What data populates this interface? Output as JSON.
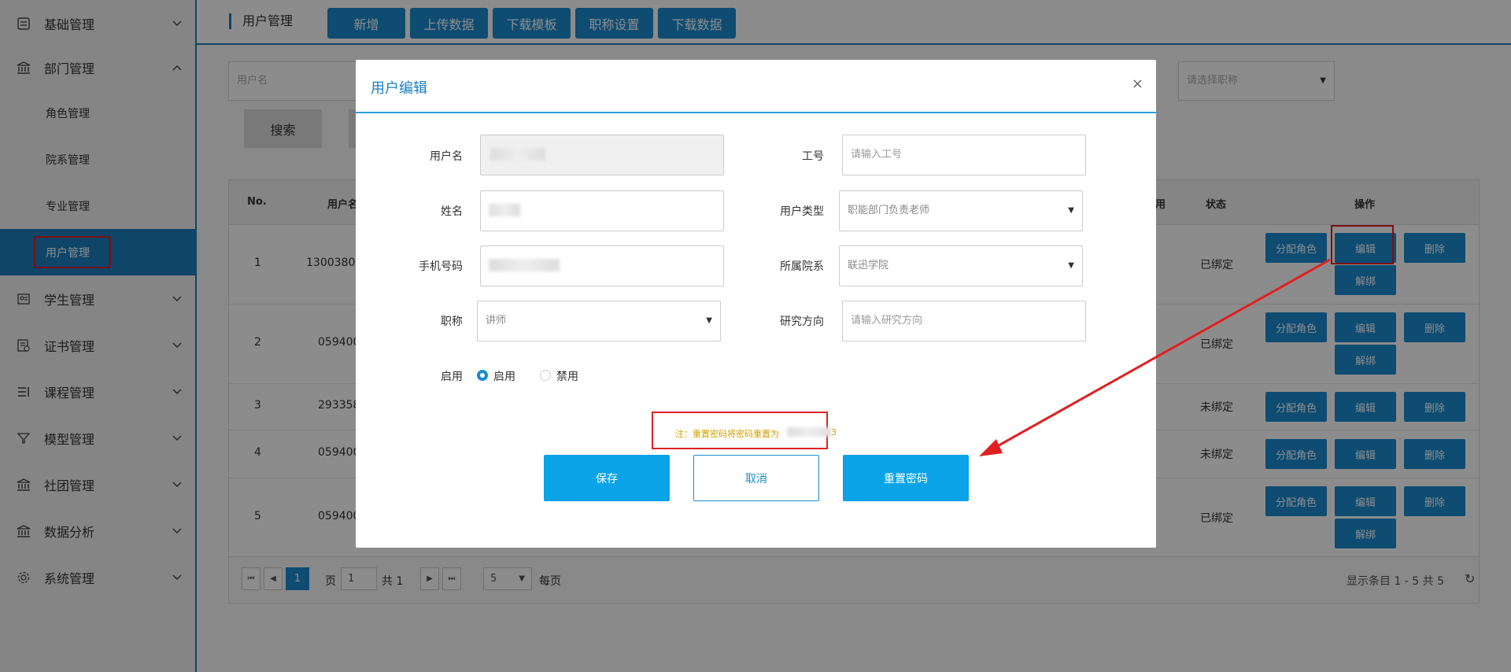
{
  "sidebar": {
    "items": [
      {
        "label": "基础管理",
        "icon": "list-icon",
        "expanded": false
      },
      {
        "label": "部门管理",
        "icon": "bank-icon",
        "expanded": true,
        "children": [
          "角色管理",
          "院系管理",
          "专业管理",
          "用户管理"
        ]
      },
      {
        "label": "学生管理",
        "icon": "student-icon",
        "expanded": false
      },
      {
        "label": "证书管理",
        "icon": "certificate-icon",
        "expanded": false
      },
      {
        "label": "课程管理",
        "icon": "course-icon",
        "expanded": false
      },
      {
        "label": "模型管理",
        "icon": "funnel-icon",
        "expanded": false
      },
      {
        "label": "社团管理",
        "icon": "bank-icon",
        "expanded": false
      },
      {
        "label": "数据分析",
        "icon": "bank-icon",
        "expanded": false
      },
      {
        "label": "系统管理",
        "icon": "gear-icon",
        "expanded": false
      }
    ]
  },
  "header": {
    "title": "用户管理",
    "buttons": [
      "新增",
      "上传数据",
      "下载模板",
      "职称设置",
      "下载数据"
    ]
  },
  "filters": {
    "username_placeholder": "用户名",
    "title_placeholder": "请选择职称",
    "search_label": "搜索"
  },
  "table": {
    "headers": {
      "no": "No.",
      "username": "用户名",
      "enabled": "用",
      "status": "状态",
      "actions": "操作"
    },
    "rows": [
      {
        "no": "1",
        "username": "13003804",
        "status": "已绑定",
        "unbind": true
      },
      {
        "no": "2",
        "username": "059400",
        "status": "已绑定",
        "unbind": true
      },
      {
        "no": "3",
        "username": "293358",
        "status": "未绑定",
        "unbind": false
      },
      {
        "no": "4",
        "username": "059400",
        "status": "未绑定",
        "unbind": false
      },
      {
        "no": "5",
        "username": "059400",
        "status": "已绑定",
        "unbind": true
      }
    ],
    "action_labels": {
      "assign_role": "分配角色",
      "edit": "编辑",
      "delete": "删除",
      "unbind": "解绑"
    }
  },
  "pager": {
    "current_page": "1",
    "page_label": "页",
    "page_input": "1",
    "total_label": "共 1",
    "page_size": "5",
    "per_page_label": "每页",
    "summary": "显示条目 1 - 5 共 5"
  },
  "modal": {
    "title": "用户编辑",
    "close": "×",
    "fields": {
      "username_label": "用户名",
      "employee_no_label": "工号",
      "employee_no_placeholder": "请输入工号",
      "name_label": "姓名",
      "user_type_label": "用户类型",
      "user_type_value": "职能部门负责老师",
      "phone_label": "手机号码",
      "department_label": "所属院系",
      "department_value": "联迅学院",
      "title_label": "职称",
      "title_value": "讲师",
      "research_label": "研究方向",
      "research_placeholder": "请输入研究方向",
      "enable_label": "启用",
      "enable_option": "启用",
      "disable_option": "禁用"
    },
    "note": "注：重置密码将密码重置为",
    "note_tail": "3",
    "buttons": {
      "save": "保存",
      "cancel": "取消",
      "reset": "重置密码"
    }
  },
  "colors": {
    "accent": "#1a8bd0",
    "highlight": "#e02020",
    "note": "#d4a000"
  }
}
